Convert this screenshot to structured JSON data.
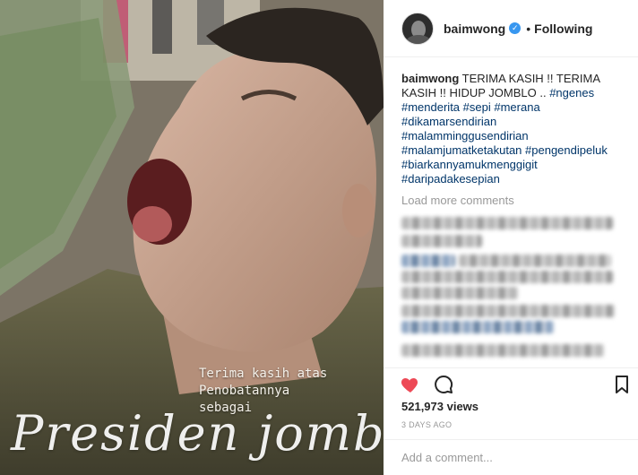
{
  "post": {
    "username": "baimwong",
    "follow_status": "Following",
    "caption": "TERIMA KASIH !! TERIMA KASIH !! HIDUP JOMBLO ..",
    "hashtags": [
      "#ngenes",
      "#menderita",
      "#sepi",
      "#merana",
      "#dikamarsendirian",
      "#malamminggusendirian",
      "#malamjumatketakutan",
      "#pengendipeluk",
      "#biarkannyamukmenggigit",
      "#daripadakesepian"
    ],
    "load_more": "Load more comments",
    "views": "521,973 views",
    "date": "3 DAYS AGO",
    "comment_placeholder": "Add a comment..."
  },
  "media": {
    "overlay_lines": [
      "Terima kasih atas",
      "Penobatannya",
      "sebagai"
    ],
    "overlay_script": "Presiden jomblo"
  },
  "colors": {
    "like": "#ed4956",
    "verified": "#3897f0",
    "hashtag": "#003569",
    "muted": "#999999"
  },
  "icons": [
    "heart-icon",
    "comment-icon",
    "bookmark-icon",
    "verified-badge-icon"
  ]
}
